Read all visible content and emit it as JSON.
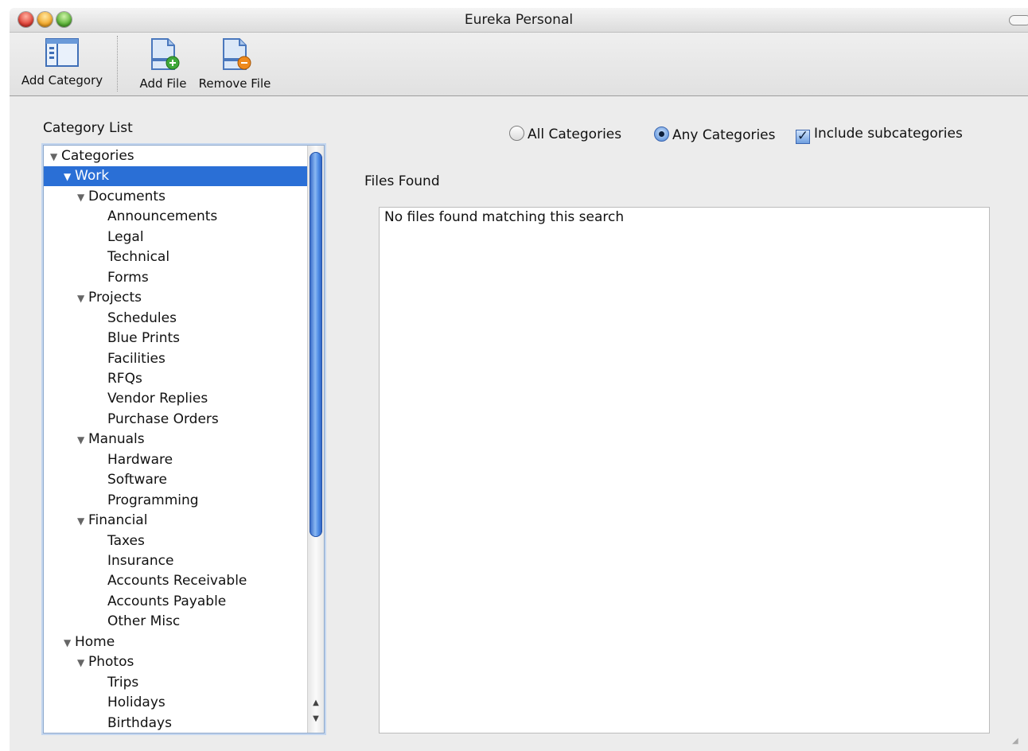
{
  "window": {
    "title": "Eureka Personal"
  },
  "toolbar": {
    "add_category": "Add Category",
    "add_file": "Add File",
    "remove_file": "Remove File"
  },
  "category_list": {
    "label": "Category List",
    "items": [
      {
        "label": "Categories",
        "depth": 0,
        "expanded": true
      },
      {
        "label": "Work",
        "depth": 1,
        "expanded": true,
        "selected": true
      },
      {
        "label": "Documents",
        "depth": 2,
        "expanded": true
      },
      {
        "label": "Announcements",
        "depth": 3
      },
      {
        "label": "Legal",
        "depth": 3
      },
      {
        "label": "Technical",
        "depth": 3
      },
      {
        "label": "Forms",
        "depth": 3
      },
      {
        "label": "Projects",
        "depth": 2,
        "expanded": true
      },
      {
        "label": "Schedules",
        "depth": 3
      },
      {
        "label": "Blue Prints",
        "depth": 3
      },
      {
        "label": "Facilities",
        "depth": 3
      },
      {
        "label": "RFQs",
        "depth": 3
      },
      {
        "label": "Vendor Replies",
        "depth": 3
      },
      {
        "label": "Purchase Orders",
        "depth": 3
      },
      {
        "label": "Manuals",
        "depth": 2,
        "expanded": true
      },
      {
        "label": "Hardware",
        "depth": 3
      },
      {
        "label": "Software",
        "depth": 3
      },
      {
        "label": "Programming",
        "depth": 3
      },
      {
        "label": "Financial",
        "depth": 2,
        "expanded": true
      },
      {
        "label": "Taxes",
        "depth": 3
      },
      {
        "label": "Insurance",
        "depth": 3
      },
      {
        "label": "Accounts Receivable",
        "depth": 3
      },
      {
        "label": "Accounts Payable",
        "depth": 3
      },
      {
        "label": "Other Misc",
        "depth": 3
      },
      {
        "label": "Home",
        "depth": 1,
        "expanded": true
      },
      {
        "label": "Photos",
        "depth": 2,
        "expanded": true
      },
      {
        "label": "Trips",
        "depth": 3
      },
      {
        "label": "Holidays",
        "depth": 3
      },
      {
        "label": "Birthdays",
        "depth": 3
      }
    ]
  },
  "search_options": {
    "all_categories": "All Categories",
    "any_categories": "Any Categories",
    "include_subcategories": "Include subcategories",
    "selected_mode": "any",
    "include_subcategories_checked": true
  },
  "files": {
    "label": "Files Found",
    "empty_message": "No files found matching this search"
  },
  "colors": {
    "selection": "#2a6fd6",
    "scroll_thumb": "#4f8de6"
  }
}
